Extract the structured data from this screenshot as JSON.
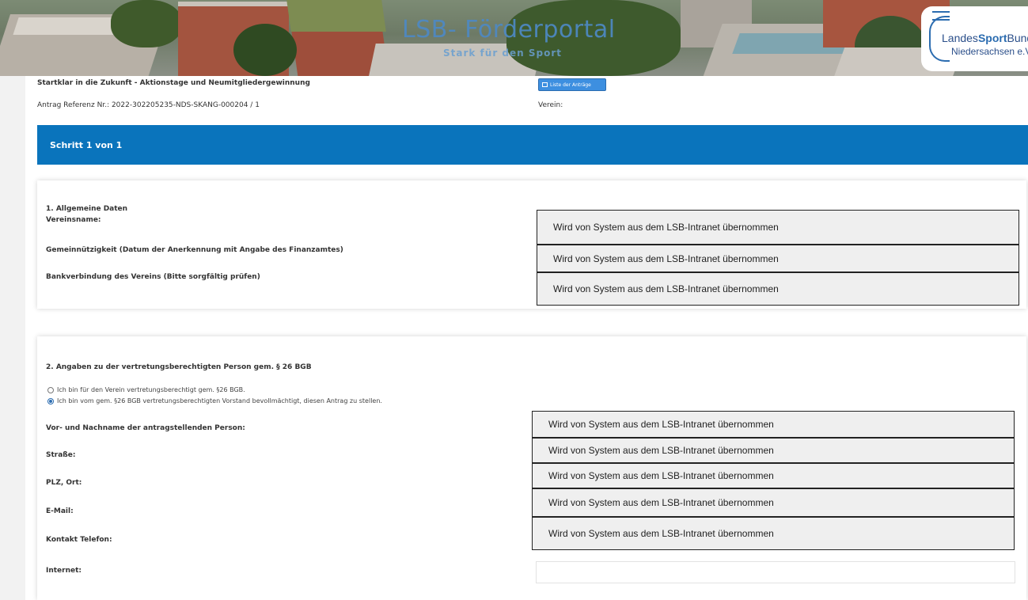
{
  "header": {
    "portal_title": "LSB- Förderportal",
    "portal_subtitle": "Stark für den Sport",
    "logo_line1_a": "Landes",
    "logo_line1_b": "Sport",
    "logo_line1_c": "Bund",
    "logo_line2": "Niedersachsen e.V."
  },
  "form_info": {
    "title": "Startklar in die Zukunft - Aktionstage und Neumitgliedergewinnung",
    "reference": "Antrag Referenz Nr.: 2022-302205235-NDS-SKANG-000204 / 1",
    "list_button": "Liste der Anträge",
    "verein_label": "Verein:"
  },
  "step": {
    "label": "Schritt 1 von 1"
  },
  "section1": {
    "heading": "1. Allgemeine Daten",
    "fields": [
      {
        "label": "Vereinsname:",
        "value": "Wird von System aus dem LSB-Intranet übernommen"
      },
      {
        "label": "Gemeinnützigkeit (Datum der Anerkennung mit Angabe des Finanzamtes)",
        "value": "Wird von System aus dem LSB-Intranet übernommen"
      },
      {
        "label": "Bankverbindung des Vereins (Bitte sorgfältig prüfen)",
        "value": "Wird von System aus dem LSB-Intranet übernommen"
      }
    ]
  },
  "section2": {
    "heading": "2. Angaben zu der vertretungsberechtigten Person gem. § 26 BGB",
    "radios": [
      {
        "label": "Ich bin für den Verein vertretungsberechtigt gem. §26 BGB.",
        "checked": false
      },
      {
        "label": "Ich bin vom gem. §26 BGB vertretungsberechtigten Vorstand bevollmächtigt, diesen Antrag zu stellen.",
        "checked": true
      }
    ],
    "fields": [
      {
        "label": "Vor- und Nachname der antragstellenden Person:",
        "value": "Wird von System aus dem LSB-Intranet übernommen"
      },
      {
        "label": "Straße:",
        "value": "Wird von System aus dem LSB-Intranet übernommen"
      },
      {
        "label": "PLZ, Ort:",
        "value": "Wird von System aus dem LSB-Intranet übernommen"
      },
      {
        "label": "E-Mail:",
        "value": "Wird von System aus dem LSB-Intranet übernommen"
      },
      {
        "label": "Kontakt Telefon:",
        "value": "Wird von System aus dem LSB-Intranet übernommen"
      },
      {
        "label": "Internet:",
        "value": ""
      }
    ]
  },
  "colors": {
    "step_bar": "#0a74bc",
    "button": "#3d8fe0",
    "field_bg": "#efefef"
  }
}
